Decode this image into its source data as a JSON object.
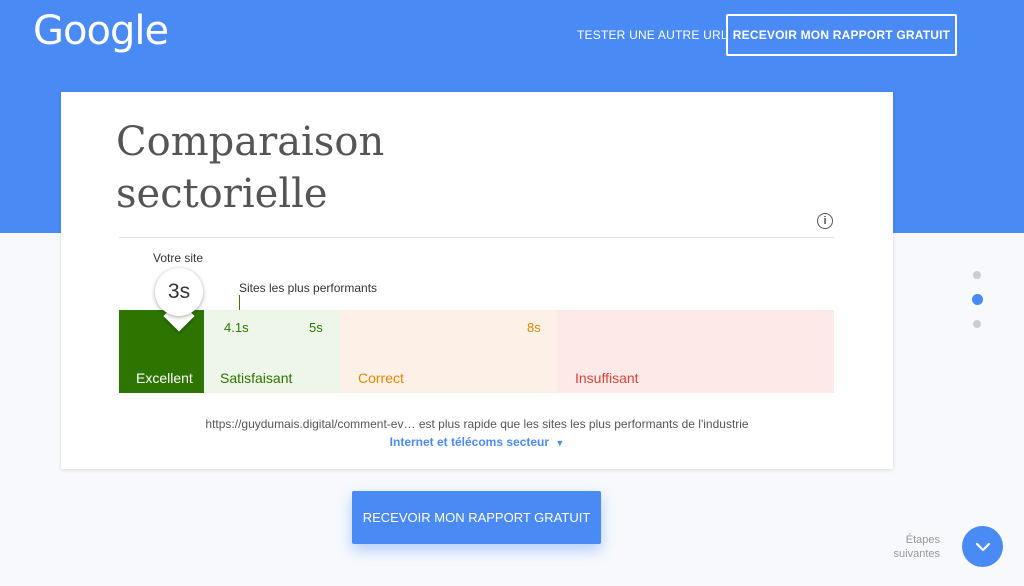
{
  "header": {
    "logo": "Google",
    "test_url_link": "TESTER UNE AUTRE URL",
    "report_button": "RECEVOIR MON RAPPORT GRATUIT"
  },
  "card": {
    "title": "Comparaison sectorielle",
    "your_site_label": "Votre site",
    "your_site_value": "3s",
    "best_sites_label": "Sites les plus performants",
    "thresholds": {
      "t1": "4.1s",
      "t2": "5s",
      "t3": "8s"
    },
    "segments": {
      "excellent": "Excellent",
      "satisfaisant": "Satisfaisant",
      "correct": "Correct",
      "insuffisant": "Insuffisant"
    },
    "summary": "https://guydumais.digital/comment-ev…  est plus rapide que les sites les plus performants de l'industrie",
    "sector_select": "Internet et télécoms secteur"
  },
  "cta_button": "RECEVOIR MON RAPPORT GRATUIT",
  "pagination": {
    "total": 3,
    "active": 2
  },
  "next_steps": {
    "line1": "Étapes",
    "line2": "suivantes"
  },
  "colors": {
    "brand": "#4a8af4",
    "excellent": "#2d7500",
    "satisfaisant": "#eef5e9",
    "correct": "#fdf0e6",
    "insuffisant": "#fde9e7"
  },
  "icons": [
    "info-icon",
    "caret-down-icon",
    "chevron-down-icon"
  ]
}
